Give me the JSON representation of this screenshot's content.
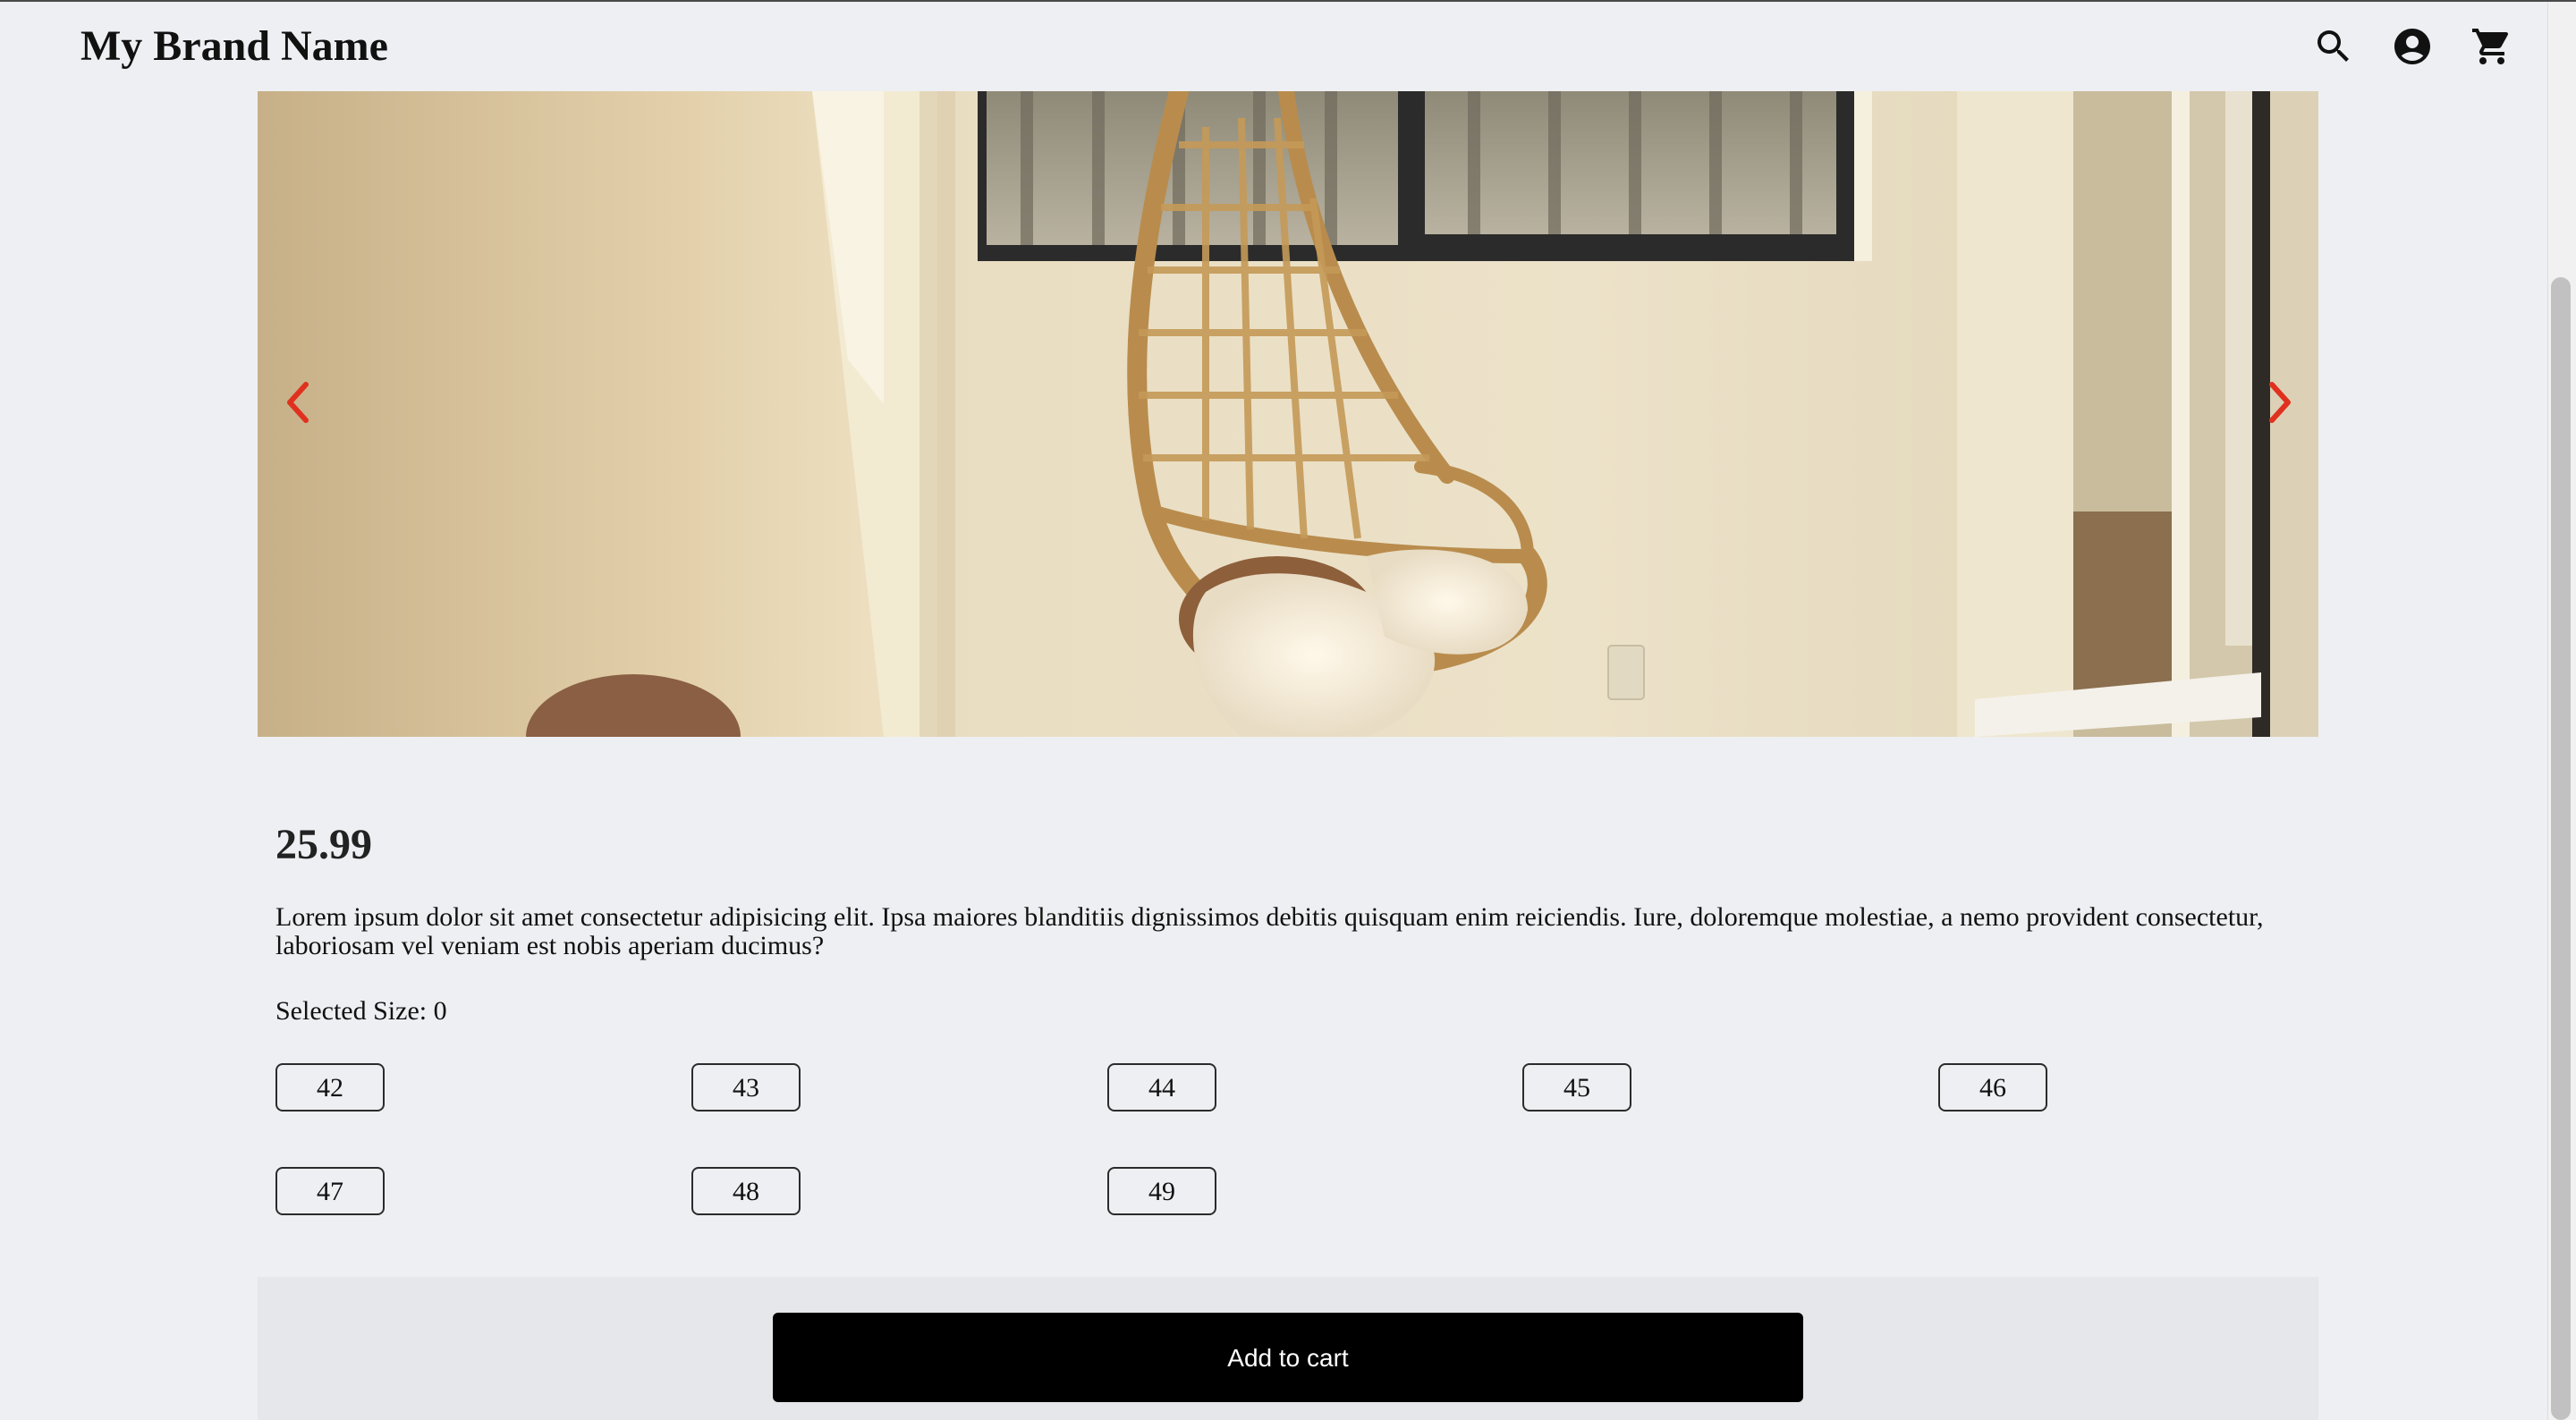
{
  "header": {
    "brand": "My Brand Name",
    "icons": [
      "search-icon",
      "account-icon",
      "cart-icon"
    ]
  },
  "carousel": {
    "prev_icon": "chevron-left-icon",
    "next_icon": "chevron-right-icon",
    "arrow_color": "#e0311f"
  },
  "product": {
    "price": "25.99",
    "description": "Lorem ipsum dolor sit amet consectetur adipisicing elit. Ipsa maiores blanditiis dignissimos debitis quisquam enim reiciendis. Iure, doloremque molestiae, a nemo provident consectetur, laboriosam vel veniam est nobis aperiam ducimus?",
    "selected_size_label": "Selected Size: 0",
    "sizes": [
      "42",
      "43",
      "44",
      "45",
      "46",
      "47",
      "48",
      "49"
    ],
    "add_to_cart_label": "Add to cart"
  }
}
